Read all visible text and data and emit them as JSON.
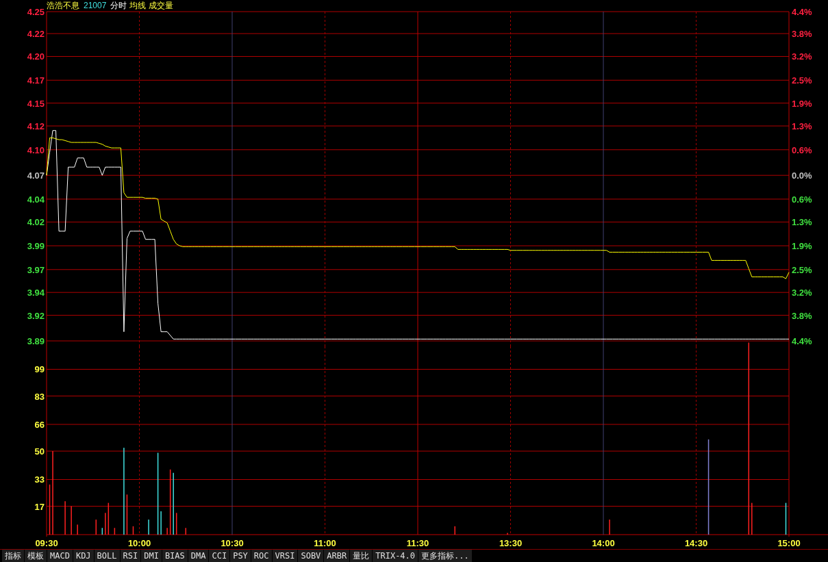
{
  "header": {
    "name": "浩浩不息",
    "code": "21007",
    "mode": "分时",
    "legend": [
      "均线",
      "成交量"
    ]
  },
  "price_chart": {
    "percent_labels": [
      {
        "label": "4.4%",
        "color": "#ff2040"
      },
      {
        "label": "3.8%",
        "color": "#ff2040"
      },
      {
        "label": "3.2%",
        "color": "#ff2040"
      },
      {
        "label": "2.5%",
        "color": "#ff2040"
      },
      {
        "label": "1.9%",
        "color": "#ff2040"
      },
      {
        "label": "1.3%",
        "color": "#ff2040"
      },
      {
        "label": "0.6%",
        "color": "#ff2040"
      },
      {
        "label": "0.0%",
        "color": "#c0c0c0"
      },
      {
        "label": "0.6%",
        "color": "#40e040"
      },
      {
        "label": "1.3%",
        "color": "#40e040"
      },
      {
        "label": "1.9%",
        "color": "#40e040"
      },
      {
        "label": "2.5%",
        "color": "#40e040"
      },
      {
        "label": "3.2%",
        "color": "#40e040"
      },
      {
        "label": "3.8%",
        "color": "#40e040"
      },
      {
        "label": "4.4%",
        "color": "#40e040"
      }
    ],
    "chart_data": {
      "type": "line",
      "categories": [
        null,
        null,
        null,
        null,
        null,
        null,
        null,
        null,
        null,
        null,
        null,
        null,
        null,
        null,
        null,
        null,
        null,
        null,
        null,
        null,
        null,
        null,
        null,
        null,
        null,
        null,
        null,
        null,
        null,
        null,
        null,
        null,
        null,
        null,
        null,
        null,
        null,
        null,
        null,
        null,
        null,
        null,
        null,
        null,
        null,
        null,
        null,
        null,
        null,
        null,
        null,
        null,
        null,
        null,
        null,
        null,
        null,
        null,
        null,
        null,
        null,
        null,
        null,
        null,
        null,
        null,
        null,
        null,
        null,
        null,
        null,
        null,
        null,
        null,
        null,
        null,
        null,
        null,
        null,
        null,
        null,
        null,
        null,
        null,
        null,
        null,
        null,
        null,
        null,
        null,
        null,
        null,
        null,
        null,
        null,
        null,
        null,
        null,
        null,
        null,
        null,
        null,
        null,
        null,
        null,
        null,
        null,
        null,
        null,
        null,
        null,
        null,
        null,
        null,
        null,
        null,
        null,
        null,
        null,
        null,
        null,
        null,
        null,
        null,
        null,
        null,
        null,
        null,
        null,
        null,
        null,
        null,
        null,
        null,
        null,
        null,
        null,
        null,
        null,
        null,
        null,
        null,
        null,
        null,
        null,
        null,
        null,
        null,
        null,
        null,
        null,
        null,
        null,
        null,
        null,
        null,
        null,
        null,
        null,
        null,
        null,
        null,
        null,
        null,
        null,
        null,
        null,
        null,
        null,
        null,
        null,
        null,
        null,
        null,
        null,
        null,
        null,
        null,
        null,
        null,
        null,
        null,
        null,
        null,
        null,
        null,
        null,
        null,
        null,
        null,
        null,
        null,
        null,
        null,
        null,
        null,
        null,
        null,
        null,
        null,
        null,
        null,
        null,
        null,
        null,
        null,
        null,
        null,
        null,
        null,
        null,
        null,
        null,
        null,
        null,
        null,
        null,
        null,
        null,
        null,
        null,
        null,
        null,
        null,
        null,
        null,
        null,
        null,
        null,
        null,
        null,
        null,
        null,
        null,
        null,
        null,
        null,
        null,
        null,
        null,
        null
      ],
      "series": [
        {
          "color": "#ffffff",
          "values": [
            4.07,
            4.095,
            4.119,
            4.119,
            4.009,
            4.009,
            4.009,
            4.079,
            4.079,
            4.079,
            4.089,
            4.089,
            4.089,
            4.079,
            4.079,
            4.079,
            4.079,
            4.079,
            4.07,
            4.079,
            4.079,
            4.079,
            4.079,
            4.079,
            4.079,
            3.899,
            4.001,
            4.009,
            4.009,
            4.009,
            4.009,
            4.009,
            4.0,
            4.0,
            4.0,
            4.0,
            3.93,
            3.899,
            3.899,
            3.899,
            3.895,
            3.891,
            3.891,
            3.891,
            3.891,
            3.891,
            3.891,
            3.891,
            3.891,
            3.891,
            3.891,
            3.891,
            3.891,
            3.891,
            3.891,
            3.891,
            3.891,
            3.891,
            3.891,
            3.891,
            3.891,
            3.891,
            3.891,
            3.891,
            3.891,
            3.891,
            3.891,
            3.891,
            3.891,
            3.891,
            3.891,
            3.891,
            3.891,
            3.891,
            3.891,
            3.891,
            3.891,
            3.891,
            3.891,
            3.891,
            3.891,
            3.891,
            3.891,
            3.891,
            3.891,
            3.891,
            3.891,
            3.891,
            3.891,
            3.891,
            3.891,
            3.891,
            3.891,
            3.891,
            3.891,
            3.891,
            3.891,
            3.891,
            3.891,
            3.891,
            3.891,
            3.891,
            3.891,
            3.891,
            3.891,
            3.891,
            3.891,
            3.891,
            3.891,
            3.891,
            3.891,
            3.891,
            3.891,
            3.891,
            3.891,
            3.891,
            3.891,
            3.891,
            3.891,
            3.891,
            3.891,
            3.891,
            3.891,
            3.891,
            3.891,
            3.891,
            3.891,
            3.891,
            3.891,
            3.891,
            3.891,
            3.891,
            3.891,
            3.891,
            3.891,
            3.891,
            3.891,
            3.891,
            3.891,
            3.891,
            3.891,
            3.891,
            3.891,
            3.891,
            3.891,
            3.891,
            3.891,
            3.891,
            3.891,
            3.891,
            3.891,
            3.891,
            3.891,
            3.891,
            3.891,
            3.891,
            3.891,
            3.891,
            3.891,
            3.891,
            3.891,
            3.891,
            3.891,
            3.891,
            3.891,
            3.891,
            3.891,
            3.891,
            3.891,
            3.891,
            3.891,
            3.891,
            3.891,
            3.891,
            3.891,
            3.891,
            3.891,
            3.891,
            3.891,
            3.891,
            3.891,
            3.891,
            3.891,
            3.891,
            3.891,
            3.891,
            3.891,
            3.891,
            3.891,
            3.891,
            3.891,
            3.891,
            3.891,
            3.891,
            3.891,
            3.891,
            3.891,
            3.891,
            3.891,
            3.891,
            3.891,
            3.891,
            3.891,
            3.891,
            3.891,
            3.891,
            3.891,
            3.891,
            3.891,
            3.891,
            3.891,
            3.891,
            3.891,
            3.891,
            3.891,
            3.891,
            3.891,
            3.891,
            3.891,
            3.891,
            3.891,
            3.891,
            3.891,
            3.891,
            3.891,
            3.891,
            3.891,
            3.891,
            3.891,
            3.891,
            3.891,
            3.891,
            3.891,
            3.891,
            3.891,
            3.891,
            3.891,
            3.891,
            3.891,
            3.891,
            3.891
          ]
        },
        {
          "color": "#ffff00",
          "values": [
            4.07,
            4.111,
            4.111,
            4.11,
            4.109,
            4.109,
            4.108,
            4.107,
            4.106,
            4.106,
            4.106,
            4.106,
            4.106,
            4.106,
            4.106,
            4.106,
            4.106,
            4.105,
            4.104,
            4.102,
            4.101,
            4.1,
            4.1,
            4.1,
            4.1,
            4.051,
            4.046,
            4.046,
            4.046,
            4.046,
            4.046,
            4.046,
            4.045,
            4.045,
            4.045,
            4.045,
            4.044,
            4.022,
            4.02,
            4.018,
            4.009,
            4.0,
            3.995,
            3.993,
            3.992,
            3.992,
            3.992,
            3.992,
            3.992,
            3.992,
            3.992,
            3.992,
            3.992,
            3.992,
            3.992,
            3.992,
            3.992,
            3.992,
            3.992,
            3.992,
            3.992,
            3.992,
            3.992,
            3.992,
            3.992,
            3.992,
            3.992,
            3.992,
            3.992,
            3.992,
            3.992,
            3.992,
            3.992,
            3.992,
            3.992,
            3.992,
            3.992,
            3.992,
            3.992,
            3.992,
            3.992,
            3.992,
            3.992,
            3.992,
            3.992,
            3.992,
            3.992,
            3.992,
            3.992,
            3.992,
            3.992,
            3.992,
            3.992,
            3.992,
            3.992,
            3.992,
            3.992,
            3.992,
            3.992,
            3.992,
            3.992,
            3.992,
            3.992,
            3.992,
            3.992,
            3.992,
            3.992,
            3.992,
            3.992,
            3.992,
            3.992,
            3.992,
            3.992,
            3.992,
            3.992,
            3.992,
            3.992,
            3.992,
            3.992,
            3.992,
            3.992,
            3.992,
            3.992,
            3.992,
            3.992,
            3.992,
            3.992,
            3.992,
            3.992,
            3.992,
            3.992,
            3.992,
            3.992,
            3.989,
            3.989,
            3.989,
            3.989,
            3.989,
            3.989,
            3.989,
            3.989,
            3.989,
            3.989,
            3.989,
            3.989,
            3.989,
            3.989,
            3.989,
            3.989,
            3.989,
            3.988,
            3.988,
            3.988,
            3.988,
            3.988,
            3.988,
            3.988,
            3.988,
            3.988,
            3.988,
            3.988,
            3.988,
            3.988,
            3.988,
            3.988,
            3.988,
            3.988,
            3.988,
            3.988,
            3.988,
            3.988,
            3.988,
            3.988,
            3.988,
            3.988,
            3.988,
            3.988,
            3.988,
            3.988,
            3.988,
            3.988,
            3.988,
            3.986,
            3.986,
            3.986,
            3.986,
            3.986,
            3.986,
            3.986,
            3.986,
            3.986,
            3.986,
            3.986,
            3.986,
            3.986,
            3.986,
            3.986,
            3.986,
            3.986,
            3.986,
            3.986,
            3.986,
            3.986,
            3.986,
            3.986,
            3.986,
            3.986,
            3.986,
            3.986,
            3.986,
            3.986,
            3.986,
            3.986,
            3.986,
            3.986,
            3.977,
            3.977,
            3.977,
            3.977,
            3.977,
            3.977,
            3.977,
            3.977,
            3.977,
            3.977,
            3.977,
            3.977,
            3.968,
            3.959,
            3.959,
            3.959,
            3.959,
            3.959,
            3.959,
            3.959,
            3.959,
            3.959,
            3.959,
            3.959,
            3.957,
            3.964
          ]
        }
      ],
      "grid": true,
      "ylim": [
        3.889,
        4.249
      ],
      "yticks": [
        {
          "value": 4.249,
          "label": "4.25"
        },
        {
          "value": 4.225,
          "label": "4.22"
        },
        {
          "value": 4.2,
          "label": "4.20"
        },
        {
          "value": 4.174,
          "label": "4.17"
        },
        {
          "value": 4.149,
          "label": "4.15"
        },
        {
          "value": 4.124,
          "label": "4.12"
        },
        {
          "value": 4.098,
          "label": "4.10"
        },
        {
          "value": 4.07,
          "label": "4.07"
        },
        {
          "value": 4.044,
          "label": "4.04"
        },
        {
          "value": 4.019,
          "label": "4.02"
        },
        {
          "value": 3.993,
          "label": "3.99"
        },
        {
          "value": 3.967,
          "label": "3.97"
        },
        {
          "value": 3.942,
          "label": "3.94"
        },
        {
          "value": 3.917,
          "label": "3.92"
        },
        {
          "value": 3.889,
          "label": "3.89"
        }
      ]
    }
  },
  "volume_chart": {
    "chart_data": {
      "type": "bar",
      "categories": [
        "09:30",
        null,
        null,
        null,
        null,
        null,
        null,
        null,
        null,
        null,
        null,
        null,
        null,
        null,
        null,
        null,
        null,
        null,
        null,
        null,
        null,
        null,
        null,
        null,
        null,
        null,
        null,
        null,
        null,
        null,
        "10:00",
        null,
        null,
        null,
        null,
        null,
        null,
        null,
        null,
        null,
        null,
        null,
        null,
        null,
        null,
        null,
        null,
        null,
        null,
        null,
        null,
        null,
        null,
        null,
        null,
        null,
        null,
        null,
        null,
        null,
        "10:30",
        null,
        null,
        null,
        null,
        null,
        null,
        null,
        null,
        null,
        null,
        null,
        null,
        null,
        null,
        null,
        null,
        null,
        null,
        null,
        null,
        null,
        null,
        null,
        null,
        null,
        null,
        null,
        null,
        null,
        "11:00",
        null,
        null,
        null,
        null,
        null,
        null,
        null,
        null,
        null,
        null,
        null,
        null,
        null,
        null,
        null,
        null,
        null,
        null,
        null,
        null,
        null,
        null,
        null,
        null,
        null,
        null,
        null,
        null,
        null,
        "11:30",
        null,
        null,
        null,
        null,
        null,
        null,
        null,
        null,
        null,
        null,
        null,
        null,
        null,
        null,
        null,
        null,
        null,
        null,
        null,
        null,
        null,
        null,
        null,
        null,
        null,
        null,
        null,
        null,
        null,
        "13:30",
        null,
        null,
        null,
        null,
        null,
        null,
        null,
        null,
        null,
        null,
        null,
        null,
        null,
        null,
        null,
        null,
        null,
        null,
        null,
        null,
        null,
        null,
        null,
        null,
        null,
        null,
        null,
        null,
        null,
        "14:00",
        null,
        null,
        null,
        null,
        null,
        null,
        null,
        null,
        null,
        null,
        null,
        null,
        null,
        null,
        null,
        null,
        null,
        null,
        null,
        null,
        null,
        null,
        null,
        null,
        null,
        null,
        null,
        null,
        null,
        "14:30",
        null,
        null,
        null,
        null,
        null,
        null,
        null,
        null,
        null,
        null,
        null,
        null,
        null,
        null,
        null,
        null,
        null,
        null,
        null,
        null,
        null,
        null,
        null,
        null,
        null,
        null,
        null,
        null,
        null,
        "15:00"
      ],
      "series": [
        {
          "color": "#ff2020",
          "values": [
            null,
            30,
            50,
            null,
            null,
            null,
            20,
            null,
            17,
            null,
            6,
            null,
            null,
            null,
            null,
            null,
            9,
            null,
            null,
            13,
            19,
            null,
            4,
            null,
            null,
            null,
            24,
            null,
            5,
            null,
            null,
            null,
            null,
            null,
            null,
            null,
            null,
            null,
            null,
            4,
            39,
            null,
            13,
            null,
            null,
            4,
            null,
            null,
            null,
            null,
            null,
            null,
            null,
            null,
            null,
            null,
            null,
            null,
            null,
            null,
            null,
            null,
            null,
            null,
            null,
            null,
            null,
            null,
            null,
            null,
            null,
            null,
            null,
            null,
            null,
            null,
            null,
            null,
            null,
            null,
            null,
            null,
            null,
            null,
            null,
            null,
            null,
            null,
            null,
            null,
            null,
            null,
            null,
            null,
            null,
            null,
            null,
            null,
            null,
            null,
            null,
            null,
            null,
            null,
            null,
            null,
            null,
            null,
            null,
            null,
            null,
            null,
            null,
            null,
            null,
            null,
            null,
            null,
            null,
            null,
            null,
            null,
            null,
            null,
            null,
            null,
            null,
            null,
            null,
            null,
            null,
            null,
            5,
            null,
            null,
            null,
            null,
            null,
            null,
            null,
            null,
            null,
            null,
            null,
            null,
            null,
            null,
            null,
            null,
            1,
            null,
            null,
            null,
            null,
            null,
            null,
            null,
            null,
            null,
            null,
            null,
            null,
            null,
            null,
            null,
            null,
            null,
            null,
            null,
            null,
            null,
            null,
            null,
            null,
            null,
            null,
            null,
            null,
            null,
            null,
            null,
            null,
            9,
            null,
            null,
            null,
            null,
            null,
            null,
            null,
            null,
            null,
            null,
            null,
            null,
            null,
            null,
            null,
            null,
            null,
            null,
            null,
            null,
            null,
            null,
            null,
            null,
            null,
            null,
            null,
            null,
            null,
            null,
            null,
            null,
            null,
            null,
            null,
            null,
            null,
            null,
            null,
            null,
            null,
            null,
            null,
            null,
            115,
            19,
            null,
            null,
            null,
            null,
            null,
            null,
            null,
            null,
            null,
            null,
            null,
            null
          ]
        },
        {
          "color": "#40e0e0",
          "values": [
            null,
            null,
            null,
            null,
            null,
            null,
            null,
            null,
            null,
            null,
            null,
            null,
            null,
            null,
            null,
            null,
            null,
            null,
            4,
            null,
            null,
            null,
            null,
            null,
            null,
            52,
            null,
            null,
            null,
            null,
            null,
            null,
            null,
            9,
            null,
            null,
            49,
            14,
            null,
            null,
            null,
            37,
            null,
            null,
            null,
            null,
            null,
            null,
            null,
            null,
            null,
            null,
            null,
            null,
            null,
            null,
            null,
            null,
            null,
            null,
            null,
            null,
            null,
            null,
            null,
            null,
            null,
            null,
            null,
            null,
            null,
            null,
            null,
            null,
            null,
            null,
            null,
            null,
            null,
            null,
            null,
            null,
            null,
            null,
            null,
            null,
            null,
            null,
            null,
            null,
            null,
            null,
            null,
            null,
            null,
            null,
            null,
            null,
            null,
            null,
            null,
            null,
            null,
            null,
            null,
            null,
            null,
            null,
            null,
            null,
            null,
            null,
            null,
            null,
            null,
            null,
            null,
            null,
            null,
            null,
            null,
            null,
            null,
            null,
            null,
            null,
            null,
            null,
            null,
            null,
            null,
            null,
            null,
            null,
            null,
            null,
            null,
            null,
            null,
            null,
            null,
            null,
            null,
            null,
            null,
            null,
            null,
            null,
            null,
            null,
            null,
            null,
            null,
            null,
            null,
            null,
            null,
            null,
            null,
            null,
            null,
            null,
            null,
            null,
            null,
            null,
            null,
            null,
            null,
            null,
            null,
            null,
            null,
            null,
            null,
            null,
            null,
            null,
            null,
            null,
            null,
            null,
            null,
            null,
            null,
            null,
            null,
            null,
            null,
            null,
            null,
            null,
            null,
            null,
            null,
            null,
            null,
            null,
            null,
            null,
            null,
            null,
            null,
            null,
            null,
            null,
            null,
            null,
            null,
            null,
            null,
            null,
            null,
            null,
            null,
            null,
            null,
            null,
            null,
            null,
            null,
            null,
            null,
            null,
            null,
            null,
            null,
            null,
            null,
            null,
            null,
            null,
            null,
            null,
            null,
            null,
            null,
            null,
            null,
            19,
            null
          ]
        },
        {
          "color": "#8080d0",
          "values": [
            null,
            null,
            null,
            null,
            null,
            null,
            null,
            null,
            null,
            null,
            null,
            null,
            null,
            null,
            null,
            null,
            null,
            null,
            null,
            null,
            null,
            null,
            null,
            null,
            null,
            null,
            null,
            null,
            null,
            null,
            null,
            null,
            null,
            null,
            null,
            null,
            null,
            null,
            null,
            null,
            null,
            null,
            null,
            null,
            null,
            null,
            null,
            null,
            null,
            null,
            null,
            null,
            null,
            null,
            null,
            null,
            null,
            null,
            null,
            null,
            null,
            null,
            null,
            null,
            null,
            null,
            null,
            null,
            null,
            null,
            null,
            null,
            null,
            null,
            null,
            null,
            null,
            null,
            null,
            null,
            null,
            null,
            null,
            null,
            null,
            null,
            null,
            null,
            null,
            null,
            null,
            null,
            null,
            null,
            null,
            null,
            null,
            null,
            null,
            null,
            null,
            null,
            null,
            null,
            null,
            null,
            null,
            null,
            null,
            null,
            null,
            null,
            null,
            null,
            null,
            null,
            null,
            null,
            null,
            null,
            null,
            null,
            null,
            null,
            null,
            null,
            null,
            null,
            null,
            null,
            null,
            null,
            null,
            null,
            null,
            null,
            null,
            null,
            null,
            null,
            null,
            null,
            null,
            null,
            null,
            null,
            null,
            null,
            null,
            null,
            null,
            null,
            null,
            null,
            null,
            null,
            null,
            null,
            null,
            null,
            null,
            null,
            null,
            null,
            null,
            null,
            null,
            null,
            null,
            null,
            null,
            null,
            null,
            null,
            null,
            null,
            null,
            null,
            null,
            null,
            null,
            null,
            null,
            null,
            null,
            null,
            null,
            null,
            null,
            null,
            null,
            null,
            null,
            null,
            null,
            null,
            null,
            null,
            null,
            null,
            null,
            null,
            null,
            null,
            null,
            null,
            null,
            null,
            null,
            null,
            null,
            null,
            null,
            null,
            57,
            null,
            null,
            null,
            null,
            null,
            null,
            null,
            null,
            null,
            null,
            null,
            null,
            null,
            null,
            null,
            null,
            null,
            null,
            null,
            null,
            null,
            null,
            null,
            null,
            null,
            null
          ]
        }
      ],
      "grid": true,
      "ylim": [
        0,
        116
      ],
      "yticks": [
        17,
        33,
        50,
        66,
        83,
        99
      ]
    }
  },
  "tabs": [
    {
      "label": "指标",
      "selected": false
    },
    {
      "label": "模板",
      "selected": false
    },
    {
      "label": "MACD",
      "selected": false
    },
    {
      "label": "KDJ",
      "selected": false
    },
    {
      "label": "BOLL",
      "selected": false
    },
    {
      "label": "RSI",
      "selected": false
    },
    {
      "label": "DMI",
      "selected": false
    },
    {
      "label": "BIAS",
      "selected": false
    },
    {
      "label": "DMA",
      "selected": false
    },
    {
      "label": "CCI",
      "selected": false
    },
    {
      "label": "PSY",
      "selected": false
    },
    {
      "label": "ROC",
      "selected": false
    },
    {
      "label": "VRSI",
      "selected": false
    },
    {
      "label": "SOBV",
      "selected": false
    },
    {
      "label": "ARBR",
      "selected": false
    },
    {
      "label": "量比",
      "selected": false
    },
    {
      "label": "TRIX-4.0",
      "selected": false
    },
    {
      "label": "更多指标...",
      "selected": false
    }
  ]
}
